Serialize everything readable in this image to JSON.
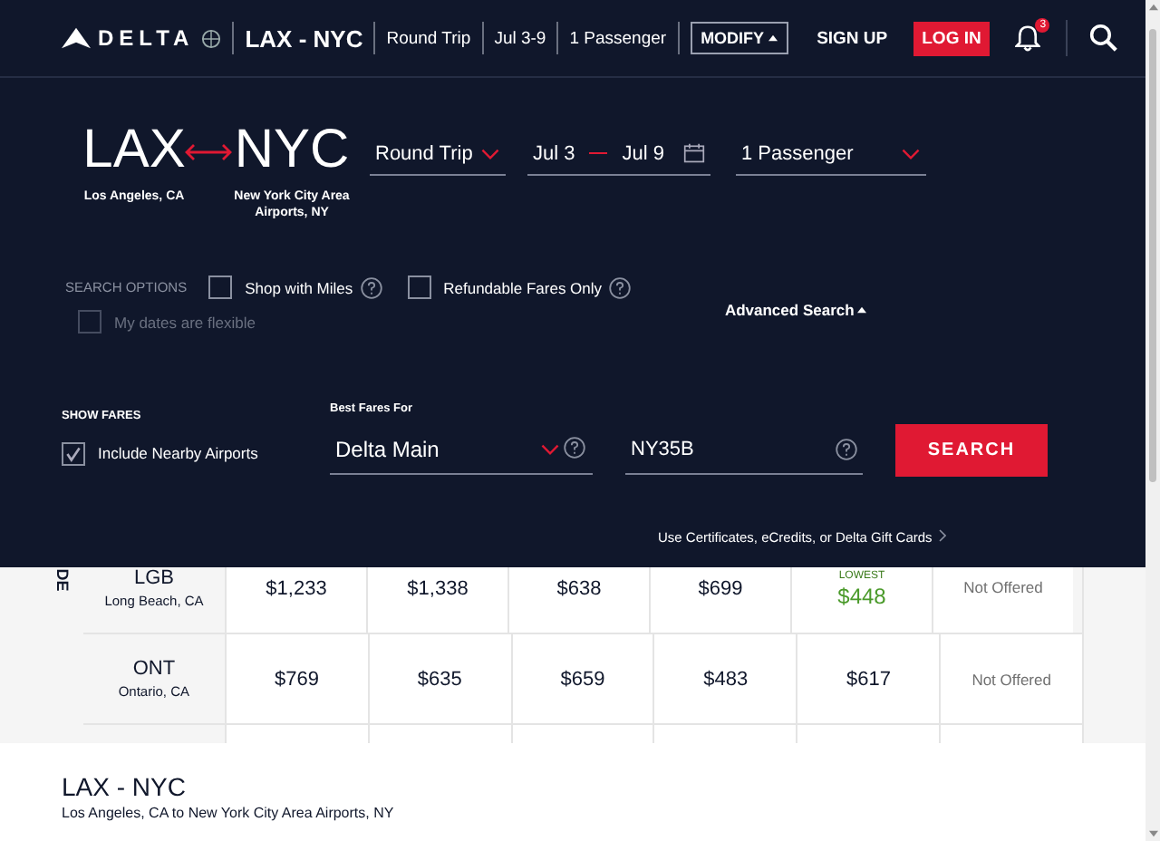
{
  "header": {
    "logo": "DELTA",
    "route": "LAX - NYC",
    "trip": "Round Trip",
    "dates": "Jul 3-9",
    "passengers": "1 Passenger",
    "modify": "MODIFY",
    "sign_up": "SIGN UP",
    "log_in": "LOG IN",
    "notifications": "3"
  },
  "search": {
    "origin": {
      "code": "LAX",
      "city": "Los Angeles, CA"
    },
    "destination": {
      "code": "NYC",
      "city": "New York City Area Airports, NY"
    },
    "trip_type": "Round Trip",
    "dates": {
      "start": "Jul 3",
      "end": "Jul 9"
    },
    "passengers": "1 Passenger",
    "options_label": "SEARCH OPTIONS",
    "options": [
      {
        "label": "Shop with Miles",
        "checked": false
      },
      {
        "label": "Refundable Fares Only",
        "checked": false
      }
    ],
    "flexible": {
      "label": "My dates are flexible",
      "checked": false,
      "disabled": true
    },
    "advanced_search": {
      "label": "Advanced Search",
      "expanded": true
    },
    "show_fares_label": "SHOW FARES",
    "nearby": {
      "label": "Include Nearby Airports",
      "checked": true
    },
    "best_fares": {
      "label": "Best Fares For",
      "value": "Delta Main"
    },
    "promo": {
      "value": "NY35B"
    },
    "search_button": "SEARCH",
    "certificates_link": "Use Certificates, eCredits, or Delta Gift Cards"
  },
  "table": {
    "side_label": "DE",
    "rows": [
      {
        "code": "LGB",
        "city": "Long Beach, CA",
        "cells": [
          {
            "kind": "price",
            "text": "$1,233",
            "lowest": false
          },
          {
            "kind": "price",
            "text": "$1,338",
            "lowest": false
          },
          {
            "kind": "price",
            "text": "$638",
            "lowest": false
          },
          {
            "kind": "price",
            "text": "$699",
            "lowest": false
          },
          {
            "kind": "price",
            "text": "$448",
            "lowest": true,
            "tag": "LOWEST"
          },
          {
            "kind": "na",
            "text": "Not Offered"
          }
        ]
      },
      {
        "code": "ONT",
        "city": "Ontario, CA",
        "cells": [
          {
            "kind": "price",
            "text": "$769",
            "lowest": false
          },
          {
            "kind": "price",
            "text": "$635",
            "lowest": false
          },
          {
            "kind": "price",
            "text": "$659",
            "lowest": false
          },
          {
            "kind": "price",
            "text": "$483",
            "lowest": false
          },
          {
            "kind": "price",
            "text": "$617",
            "lowest": false
          },
          {
            "kind": "na",
            "text": "Not Offered"
          }
        ]
      }
    ]
  },
  "footer": {
    "route": "LAX - NYC",
    "subtitle": "Los Angeles, CA to New York City Area Airports, NY"
  }
}
